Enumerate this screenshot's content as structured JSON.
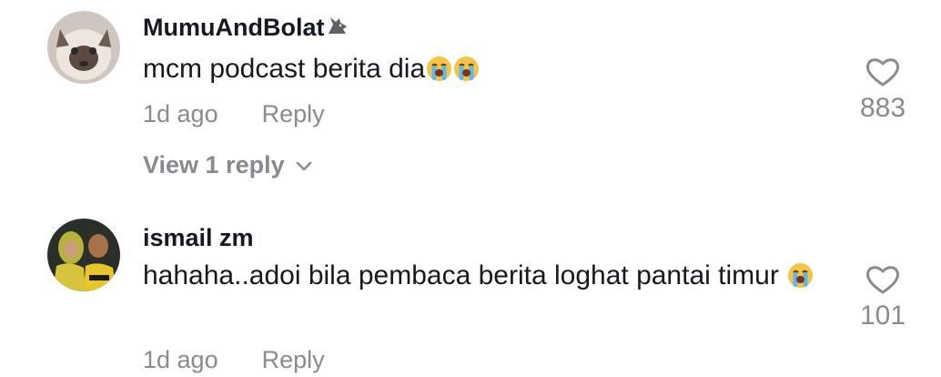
{
  "comments": [
    {
      "username": "MumuAndBolat",
      "username_badge_icon": "wolf-emoji-icon",
      "text": "mcm podcast berita dia",
      "text_emojis": [
        "loudly-crying-face-icon",
        "loudly-crying-face-icon"
      ],
      "time": "1d ago",
      "reply_label": "Reply",
      "likes": "883",
      "view_replies_label": "View 1 reply"
    },
    {
      "username": "ismail zm",
      "text": "hahaha..adoi bila pembaca berita loghat pantai timur",
      "text_emojis": [
        "loudly-crying-face-icon"
      ],
      "time": "1d ago",
      "reply_label": "Reply",
      "likes": "101"
    }
  ],
  "colors": {
    "primary_text": "#161823",
    "secondary_text": "#8a8b91"
  }
}
